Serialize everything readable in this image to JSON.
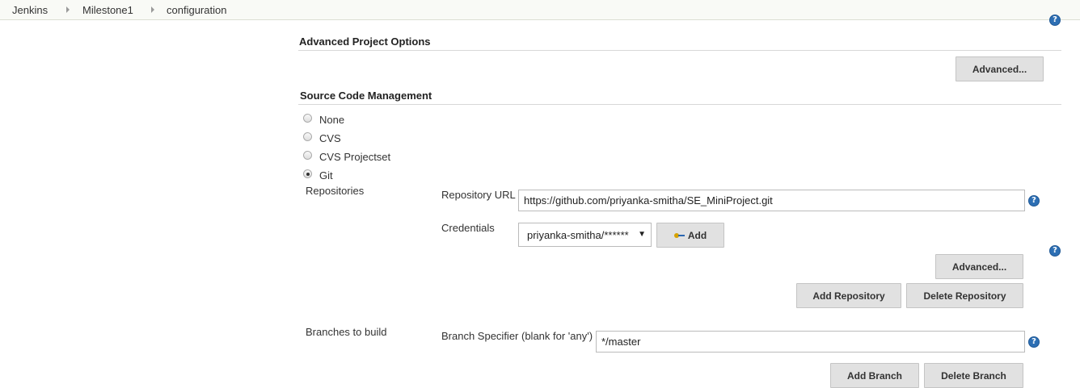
{
  "breadcrumb": {
    "items": [
      "Jenkins",
      "Milestone1",
      "configuration"
    ]
  },
  "advanced_project_options": {
    "title": "Advanced Project Options",
    "advanced_button": "Advanced..."
  },
  "scm": {
    "title": "Source Code Management",
    "options": [
      "None",
      "CVS",
      "CVS Projectset",
      "Git"
    ],
    "selected": "Git",
    "repositories_label": "Repositories",
    "repository_url_label": "Repository URL",
    "repository_url_value": "https://github.com/priyanka-smitha/SE_MiniProject.git",
    "credentials_label": "Credentials",
    "credentials_value": "priyanka-smitha/******",
    "add_button": "Add",
    "advanced_button": "Advanced...",
    "add_repository_button": "Add Repository",
    "delete_repository_button": "Delete Repository",
    "branches_label": "Branches to build",
    "branch_specifier_label": "Branch Specifier (blank for 'any')",
    "branch_specifier_value": "*/master",
    "add_branch_button": "Add Branch",
    "delete_branch_button": "Delete Branch"
  },
  "icons": {
    "help": "help-icon",
    "dropdown": "chevron-down-icon",
    "key": "key-icon",
    "breadcrumb_separator": "chevron-right-icon"
  },
  "colors": {
    "breadcrumb_bg": "#f9faf6",
    "button_bg": "#e1e1e1",
    "help_icon": "#2d6fb4"
  }
}
